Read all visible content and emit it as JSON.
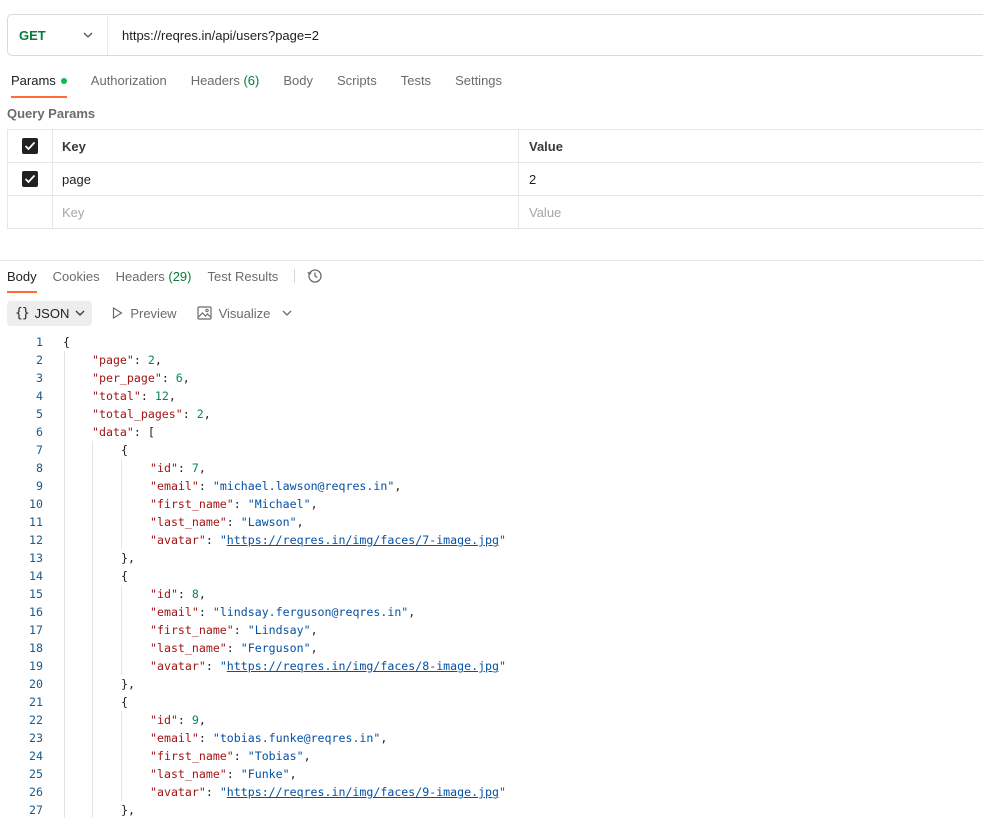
{
  "request": {
    "method": "GET",
    "url": "https://reqres.in/api/users?page=2"
  },
  "request_tabs": [
    {
      "label": "Params",
      "count": "",
      "dot": true
    },
    {
      "label": "Authorization",
      "count": "",
      "dot": false
    },
    {
      "label": "Headers",
      "count": "(6)",
      "dot": false
    },
    {
      "label": "Body",
      "count": "",
      "dot": false
    },
    {
      "label": "Scripts",
      "count": "",
      "dot": false
    },
    {
      "label": "Tests",
      "count": "",
      "dot": false
    },
    {
      "label": "Settings",
      "count": "",
      "dot": false
    }
  ],
  "query_params": {
    "title": "Query Params",
    "header": {
      "key": "Key",
      "value": "Value"
    },
    "rows": [
      {
        "key": "page",
        "value": "2",
        "checked": true
      }
    ],
    "placeholder": {
      "key": "Key",
      "value": "Value"
    }
  },
  "response_tabs": [
    {
      "label": "Body",
      "count": ""
    },
    {
      "label": "Cookies",
      "count": ""
    },
    {
      "label": "Headers",
      "count": "(29)"
    },
    {
      "label": "Test Results",
      "count": ""
    }
  ],
  "format_bar": {
    "format_icon": "{}",
    "format_label": "JSON",
    "preview_label": "Preview",
    "visualize_label": "Visualize"
  },
  "code_lines": [
    {
      "n": "1",
      "indent": 0,
      "tokens": [
        [
          "p",
          "{"
        ]
      ]
    },
    {
      "n": "2",
      "indent": 1,
      "tokens": [
        [
          "k",
          "\"page\""
        ],
        [
          "p",
          ": "
        ],
        [
          "n",
          "2"
        ],
        [
          "p",
          ","
        ]
      ]
    },
    {
      "n": "3",
      "indent": 1,
      "tokens": [
        [
          "k",
          "\"per_page\""
        ],
        [
          "p",
          ": "
        ],
        [
          "n",
          "6"
        ],
        [
          "p",
          ","
        ]
      ]
    },
    {
      "n": "4",
      "indent": 1,
      "tokens": [
        [
          "k",
          "\"total\""
        ],
        [
          "p",
          ": "
        ],
        [
          "n",
          "12"
        ],
        [
          "p",
          ","
        ]
      ]
    },
    {
      "n": "5",
      "indent": 1,
      "tokens": [
        [
          "k",
          "\"total_pages\""
        ],
        [
          "p",
          ": "
        ],
        [
          "n",
          "2"
        ],
        [
          "p",
          ","
        ]
      ]
    },
    {
      "n": "6",
      "indent": 1,
      "tokens": [
        [
          "k",
          "\"data\""
        ],
        [
          "p",
          ": ["
        ]
      ]
    },
    {
      "n": "7",
      "indent": 2,
      "tokens": [
        [
          "p",
          "{"
        ]
      ]
    },
    {
      "n": "8",
      "indent": 3,
      "tokens": [
        [
          "k",
          "\"id\""
        ],
        [
          "p",
          ": "
        ],
        [
          "n",
          "7"
        ],
        [
          "p",
          ","
        ]
      ]
    },
    {
      "n": "9",
      "indent": 3,
      "tokens": [
        [
          "k",
          "\"email\""
        ],
        [
          "p",
          ": "
        ],
        [
          "s",
          "\"michael.lawson@reqres.in\""
        ],
        [
          "p",
          ","
        ]
      ]
    },
    {
      "n": "10",
      "indent": 3,
      "tokens": [
        [
          "k",
          "\"first_name\""
        ],
        [
          "p",
          ": "
        ],
        [
          "s",
          "\"Michael\""
        ],
        [
          "p",
          ","
        ]
      ]
    },
    {
      "n": "11",
      "indent": 3,
      "tokens": [
        [
          "k",
          "\"last_name\""
        ],
        [
          "p",
          ": "
        ],
        [
          "s",
          "\"Lawson\""
        ],
        [
          "p",
          ","
        ]
      ]
    },
    {
      "n": "12",
      "indent": 3,
      "tokens": [
        [
          "k",
          "\"avatar\""
        ],
        [
          "p",
          ": "
        ],
        [
          "s",
          "\""
        ],
        [
          "u",
          "https://reqres.in/img/faces/7-image.jpg"
        ],
        [
          "s",
          "\""
        ]
      ]
    },
    {
      "n": "13",
      "indent": 2,
      "tokens": [
        [
          "p",
          "},"
        ]
      ]
    },
    {
      "n": "14",
      "indent": 2,
      "tokens": [
        [
          "p",
          "{"
        ]
      ]
    },
    {
      "n": "15",
      "indent": 3,
      "tokens": [
        [
          "k",
          "\"id\""
        ],
        [
          "p",
          ": "
        ],
        [
          "n",
          "8"
        ],
        [
          "p",
          ","
        ]
      ]
    },
    {
      "n": "16",
      "indent": 3,
      "tokens": [
        [
          "k",
          "\"email\""
        ],
        [
          "p",
          ": "
        ],
        [
          "s",
          "\"lindsay.ferguson@reqres.in\""
        ],
        [
          "p",
          ","
        ]
      ]
    },
    {
      "n": "17",
      "indent": 3,
      "tokens": [
        [
          "k",
          "\"first_name\""
        ],
        [
          "p",
          ": "
        ],
        [
          "s",
          "\"Lindsay\""
        ],
        [
          "p",
          ","
        ]
      ]
    },
    {
      "n": "18",
      "indent": 3,
      "tokens": [
        [
          "k",
          "\"last_name\""
        ],
        [
          "p",
          ": "
        ],
        [
          "s",
          "\"Ferguson\""
        ],
        [
          "p",
          ","
        ]
      ]
    },
    {
      "n": "19",
      "indent": 3,
      "tokens": [
        [
          "k",
          "\"avatar\""
        ],
        [
          "p",
          ": "
        ],
        [
          "s",
          "\""
        ],
        [
          "u",
          "https://reqres.in/img/faces/8-image.jpg"
        ],
        [
          "s",
          "\""
        ]
      ]
    },
    {
      "n": "20",
      "indent": 2,
      "tokens": [
        [
          "p",
          "},"
        ]
      ]
    },
    {
      "n": "21",
      "indent": 2,
      "tokens": [
        [
          "p",
          "{"
        ]
      ]
    },
    {
      "n": "22",
      "indent": 3,
      "tokens": [
        [
          "k",
          "\"id\""
        ],
        [
          "p",
          ": "
        ],
        [
          "n",
          "9"
        ],
        [
          "p",
          ","
        ]
      ]
    },
    {
      "n": "23",
      "indent": 3,
      "tokens": [
        [
          "k",
          "\"email\""
        ],
        [
          "p",
          ": "
        ],
        [
          "s",
          "\"tobias.funke@reqres.in\""
        ],
        [
          "p",
          ","
        ]
      ]
    },
    {
      "n": "24",
      "indent": 3,
      "tokens": [
        [
          "k",
          "\"first_name\""
        ],
        [
          "p",
          ": "
        ],
        [
          "s",
          "\"Tobias\""
        ],
        [
          "p",
          ","
        ]
      ]
    },
    {
      "n": "25",
      "indent": 3,
      "tokens": [
        [
          "k",
          "\"last_name\""
        ],
        [
          "p",
          ": "
        ],
        [
          "s",
          "\"Funke\""
        ],
        [
          "p",
          ","
        ]
      ]
    },
    {
      "n": "26",
      "indent": 3,
      "tokens": [
        [
          "k",
          "\"avatar\""
        ],
        [
          "p",
          ": "
        ],
        [
          "s",
          "\""
        ],
        [
          "u",
          "https://reqres.in/img/faces/9-image.jpg"
        ],
        [
          "s",
          "\""
        ]
      ]
    },
    {
      "n": "27",
      "indent": 2,
      "tokens": [
        [
          "p",
          "},"
        ]
      ]
    }
  ]
}
